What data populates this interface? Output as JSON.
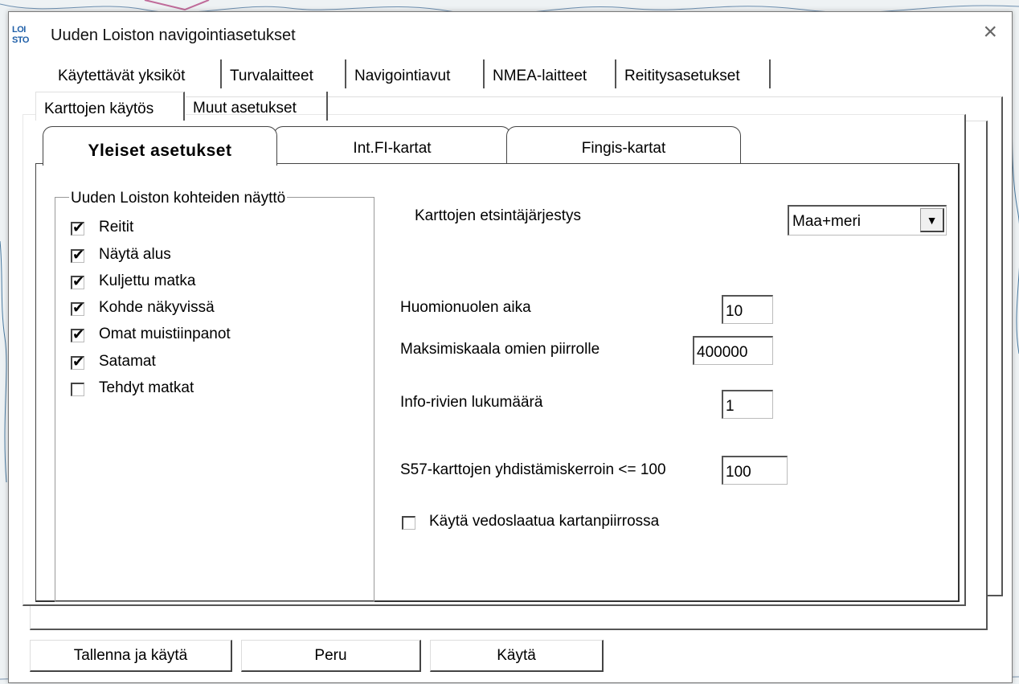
{
  "window": {
    "logo": "LOI STO",
    "title": "Uuden Loiston navigointiasetukset",
    "close_glyph": "×"
  },
  "outer_tabs_row1": [
    "Käytettävät yksiköt",
    "Turvalaitteet",
    "Navigointiavut",
    "NMEA-laitteet",
    "Reititysasetukset"
  ],
  "outer_tabs_row2": [
    "Karttojen käytös",
    "Muut asetukset"
  ],
  "inner_tabs": [
    "Yleiset asetukset",
    "Int.FI-kartat",
    "Fingis-kartat"
  ],
  "inner_tab_active": "Yleiset asetukset",
  "group": {
    "label": "Uuden Loiston kohteiden näyttö",
    "items": [
      {
        "label": "Reitit",
        "checked": true
      },
      {
        "label": "Näytä alus",
        "checked": true
      },
      {
        "label": "Kuljettu matka",
        "checked": true
      },
      {
        "label": "Kohde näkyvissä",
        "checked": true
      },
      {
        "label": "Omat muistiinpanot",
        "checked": true
      },
      {
        "label": "Satamat",
        "checked": true
      },
      {
        "label": "Tehdyt matkat",
        "checked": false
      }
    ]
  },
  "settings": {
    "search_order_label": "Karttojen etsintäjärjestys",
    "search_order_value": "Maa+meri",
    "attention_label": "Huomionuolen aika",
    "attention_value": "10",
    "max_scale_label": "Maksimiskaala omien piirrolle",
    "max_scale_value": "400000",
    "info_rows_label": "Info-rivien lukumäärä",
    "info_rows_value": "1",
    "s57_label": "S57-karttojen yhdistämiskerroin <= 100",
    "s57_value": "100",
    "print_quality_label": "Käytä vedoslaatua kartanpiirrossa",
    "print_quality_checked": false
  },
  "buttons": {
    "save_apply": "Tallenna ja käytä",
    "cancel": "Peru",
    "apply": "Käytä"
  },
  "icons": {
    "check": "✔",
    "dropdown": "▼"
  }
}
